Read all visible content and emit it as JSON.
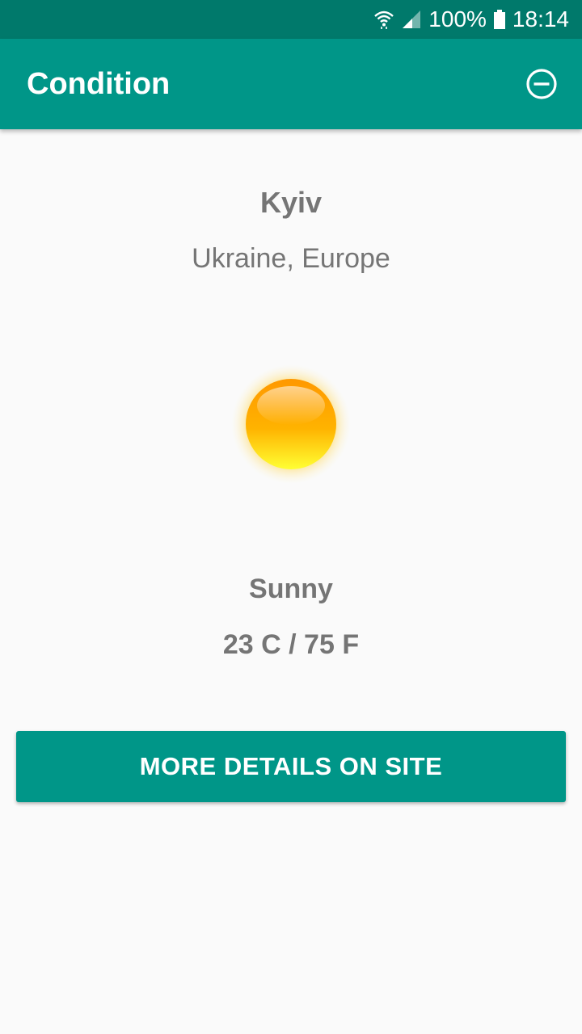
{
  "status_bar": {
    "battery_percent": "100%",
    "time": "18:14",
    "icons": [
      "wifi-icon",
      "cell-signal-icon",
      "battery-icon"
    ]
  },
  "app_bar": {
    "title": "Condition",
    "action_icon": "remove-circle-icon"
  },
  "location": {
    "city": "Kyiv",
    "region": "Ukraine, Europe"
  },
  "weather": {
    "icon": "sun-icon",
    "condition": "Sunny",
    "temperature": "23 C / 75 F"
  },
  "details_button": {
    "label": "MORE DETAILS ON SITE"
  },
  "colors": {
    "status_bar": "#00796b",
    "primary": "#009688",
    "text_secondary": "#757575",
    "background": "#fafafa"
  }
}
